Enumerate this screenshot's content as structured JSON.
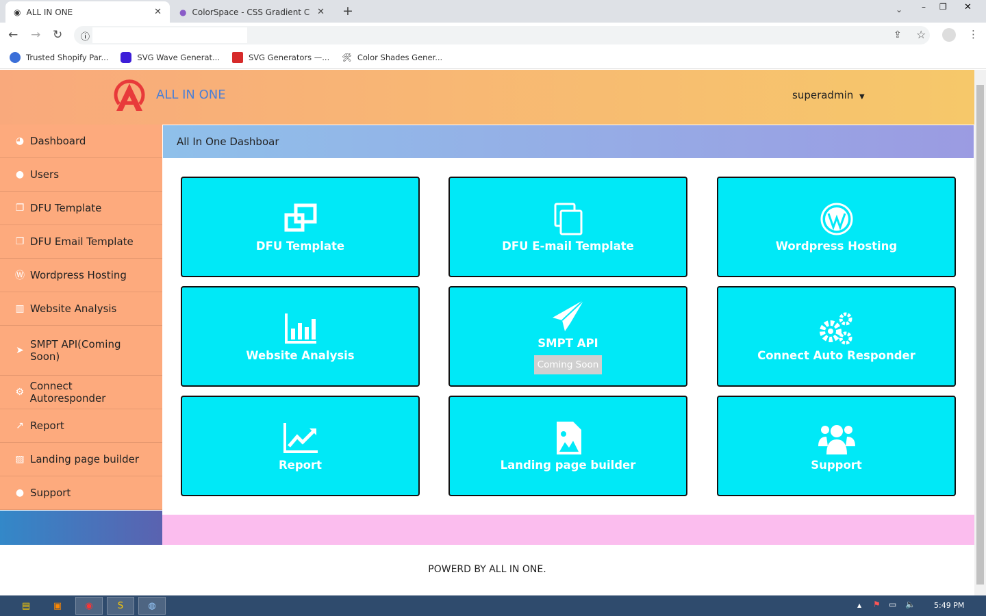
{
  "browser": {
    "tabs": [
      {
        "title": "ALL IN ONE",
        "active": true
      },
      {
        "title": "ColorSpace - CSS Gradient Color",
        "active": false
      }
    ],
    "bookmarks": [
      {
        "label": "Trusted Shopify Par...",
        "color": "#3b6fd8"
      },
      {
        "label": "SVG Wave Generat...",
        "color": "#3d1ed8"
      },
      {
        "label": "SVG Generators —...",
        "color": "#d62a2a"
      },
      {
        "label": "Color Shades Gener...",
        "color": "#888888"
      }
    ]
  },
  "header": {
    "brand": "ALL IN ONE",
    "user": "superadmin"
  },
  "sidebar": {
    "items": [
      {
        "label": "Dashboard",
        "icon": "dashboard-icon",
        "glyph": "◕"
      },
      {
        "label": "Users",
        "icon": "user-icon",
        "glyph": "●"
      },
      {
        "label": "DFU Template",
        "icon": "clone-icon",
        "glyph": "❐"
      },
      {
        "label": "DFU Email Template",
        "icon": "clone-icon",
        "glyph": "❐"
      },
      {
        "label": "Wordpress Hosting",
        "icon": "wordpress-icon",
        "glyph": "Ⓦ"
      },
      {
        "label": "Website Analysis",
        "icon": "bar-chart-icon",
        "glyph": "▥"
      },
      {
        "label": "SMPT API(Coming Soon)",
        "icon": "paper-plane-icon",
        "glyph": "➤"
      },
      {
        "label": "Connect Autoresponder",
        "icon": "cogs-icon",
        "glyph": "⚙"
      },
      {
        "label": "Report",
        "icon": "line-chart-icon",
        "glyph": "↗"
      },
      {
        "label": "Landing page builder",
        "icon": "image-file-icon",
        "glyph": "▨"
      },
      {
        "label": "Support",
        "icon": "users-icon",
        "glyph": "●"
      }
    ]
  },
  "content": {
    "title": "All In One Dashboar",
    "cards": [
      {
        "label": "DFU Template",
        "icon": "clone-icon"
      },
      {
        "label": "DFU E-mail Template",
        "icon": "copy-icon"
      },
      {
        "label": "Wordpress Hosting",
        "icon": "wordpress-icon"
      },
      {
        "label": "Website Analysis",
        "icon": "bar-chart-icon"
      },
      {
        "label": "SMPT API",
        "icon": "paper-plane-icon",
        "badge": "Coming Soon"
      },
      {
        "label": "Connect Auto Responder",
        "icon": "cogs-icon"
      },
      {
        "label": "Report",
        "icon": "line-chart-icon"
      },
      {
        "label": "Landing page builder",
        "icon": "image-file-icon"
      },
      {
        "label": "Support",
        "icon": "users-icon"
      }
    ]
  },
  "footer": {
    "text": "POWERD BY ALL IN ONE."
  },
  "taskbar": {
    "clock": "5:49 PM"
  },
  "colors": {
    "card": "#00e9f7",
    "sidebar": "#fdaa7d",
    "pink": "#fbbdee"
  }
}
